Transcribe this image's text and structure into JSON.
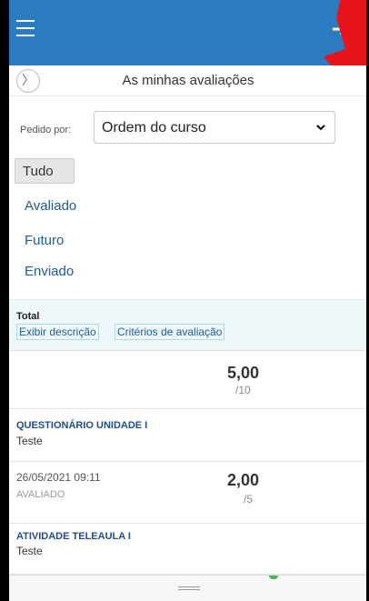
{
  "header": {
    "menu_icon": "hamburger-menu-icon",
    "right_icon": "logout-arrow-icon",
    "accent_color": "#2b7bc0"
  },
  "title_row": {
    "nav_icon": "chevron-right-icon",
    "nav_glyph": "〉",
    "title": "As minhas avaliações"
  },
  "sort": {
    "label": "Pedido por:",
    "selected": "Ordem do curso"
  },
  "filters": [
    "Tudo",
    "Avaliado",
    "Futuro",
    "Enviado"
  ],
  "total": {
    "label": "Total",
    "show_description": "Exibir descrição",
    "criteria": "Critérios de avaliação",
    "score": "5,00",
    "max": "/10"
  },
  "items": [
    {
      "title": "QUESTIONÁRIO UNIDADE I",
      "subtitle": "Teste",
      "date": "26/05/2021 09:11",
      "status": "AVALIADO",
      "score": "2,00",
      "max": "/5"
    },
    {
      "title": "ATIVIDADE TELEAULA I",
      "subtitle": "Teste"
    }
  ]
}
